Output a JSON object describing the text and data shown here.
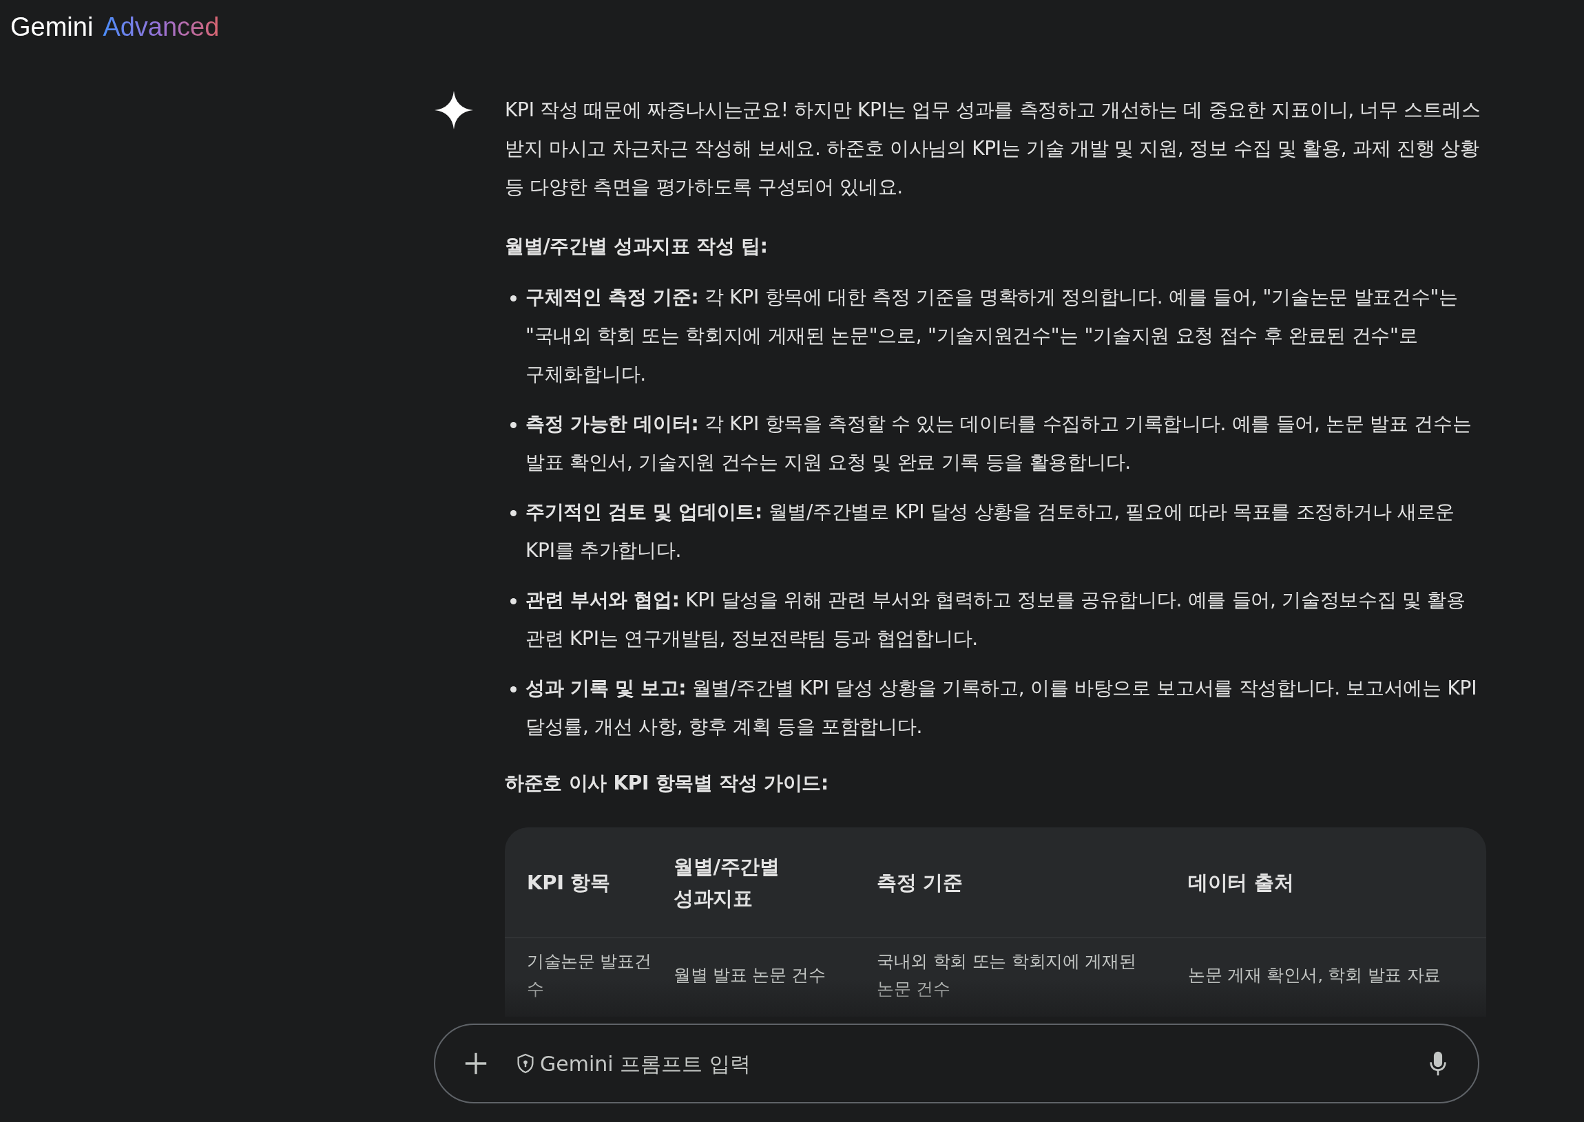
{
  "header": {
    "brand": "Gemini",
    "tier": "Advanced"
  },
  "response": {
    "intro": "KPI 작성 때문에 짜증나시는군요! 하지만 KPI는 업무 성과를 측정하고 개선하는 데 중요한 지표이니, 너무 스트레스 받지 마시고 차근차근 작성해 보세요. 하준호 이사님의 KPI는 기술 개발 및 지원, 정보 수집 및 활용, 과제 진행 상황 등 다양한 측면을 평가하도록 구성되어 있네요.",
    "tips_heading": "월별/주간별 성과지표 작성 팁:",
    "tips": [
      "**구체적인 측정 기준:** 각 KPI 항목에 대한 측정 기준을 명확하게 정의합니다. 예를 들어, \"기술논문 발표건수\"는 \"국내외 학회 또는 학회지에 게재된 논문\"으로, \"기술지원건수\"는 \"기술지원 요청 접수 후 완료된 건수\"로 구체화합니다.",
      "**측정 가능한 데이터:** 각 KPI 항목을 측정할 수 있는 데이터를 수집하고 기록합니다. 예를 들어, 논문 발표 건수는 발표 확인서, 기술지원 건수는 지원 요청 및 완료 기록 등을 활용합니다.",
      "**주기적인 검토 및 업데이트:** 월별/주간별로 KPI 달성 상황을 검토하고, 필요에 따라 목표를 조정하거나 새로운 KPI를 추가합니다.",
      "**관련 부서와 협업:** KPI 달성을 위해 관련 부서와 협력하고 정보를 공유합니다. 예를 들어, 기술정보수집 및 활용 관련 KPI는 연구개발팀, 정보전략팀 등과 협업합니다.",
      "**성과 기록 및 보고:** 월별/주간별 KPI 달성 상황을 기록하고, 이를 바탕으로 보고서를 작성합니다. 보고서에는 KPI 달성률, 개선 사항, 향후 계획 등을 포함합니다."
    ],
    "guide_heading": "하준호 이사 KPI 항목별 작성 가이드:",
    "table": {
      "columns": [
        "KPI 항목",
        "월별/주간별 성과지표",
        "측정 기준",
        "데이터 출처"
      ],
      "rows": [
        [
          "기술논문 발표건수",
          "월별 발표 논문 건수",
          "국내외 학회 또는 학회지에 게재된 논문 건수",
          "논문 게재 확인서, 학회 발표 자료"
        ]
      ]
    }
  },
  "prompt": {
    "placeholder": "Gemini 프롬프트 입력"
  }
}
